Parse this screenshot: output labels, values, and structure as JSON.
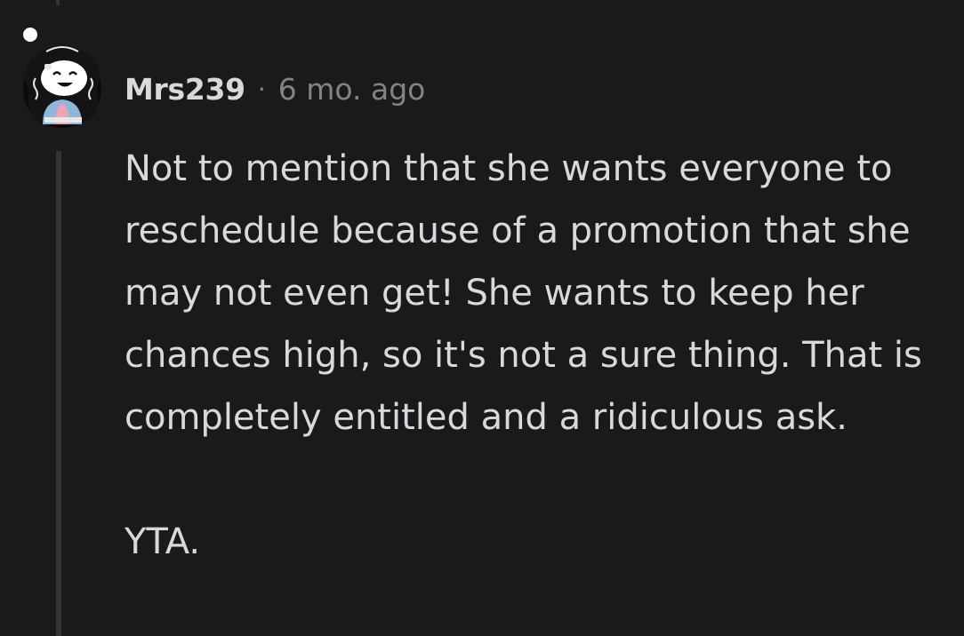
{
  "comment": {
    "username": "Mrs239",
    "separator": "·",
    "time": "6 mo. ago",
    "paragraphs": [
      "Not to mention that she wants everyone to reschedule because of a promotion that she may not even get! She wants to keep her chances high, so it's not a sure thing. That is completely entitled and a ridiculous ask.",
      "YTA."
    ]
  },
  "colors": {
    "background": "#1a1a1b",
    "text": "#d7dadc",
    "meta": "#818384",
    "thread_line": "#343536"
  },
  "icons": {
    "avatar": "snoo-avatar-icon"
  }
}
